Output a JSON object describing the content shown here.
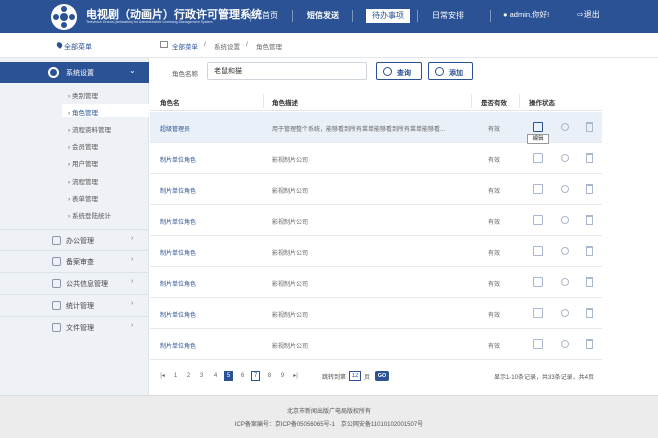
{
  "header": {
    "title": "电视剧（动画片）行政许可管理系统",
    "subtitle": "Television Drama (Animation) for Administrative Licensing Management System",
    "nav": [
      "首页",
      "短信发送",
      "待办事项",
      "日常安排"
    ],
    "active_nav": "待办事项",
    "user": "admin,你好!",
    "logout": "退出"
  },
  "sidebar": {
    "all_menu": "全部菜单",
    "active_group": "系统设置",
    "sub_items": [
      "类别管理",
      "角色管理",
      "流程资料管理",
      "会员管理",
      "用户管理",
      "流程管理",
      "表单管理",
      "系统登陆统计"
    ],
    "groups": [
      "办公管理",
      "备案审查",
      "公共信息管理",
      "统计管理",
      "文件管理"
    ]
  },
  "breadcrumb": [
    "全部菜单",
    "/",
    "系统设置",
    "/",
    "角色管理"
  ],
  "search": {
    "label": "角色名称",
    "value": "老鼠和猫",
    "query_button": "查询",
    "add_button": "添加"
  },
  "table": {
    "headers": [
      "角色名",
      "角色描述",
      "是否有效",
      "操作状态"
    ],
    "rows": [
      {
        "name": "超级管理员",
        "desc": "用于管理整个系统，能够看到所有菜单能够看到所有菜单能够看...",
        "valid": "有效"
      },
      {
        "name": "制片单位角色",
        "desc": "影视制片公司",
        "valid": "有效"
      },
      {
        "name": "制片单位角色",
        "desc": "影视制片公司",
        "valid": "有效"
      },
      {
        "name": "制片单位角色",
        "desc": "影视制片公司",
        "valid": "有效"
      },
      {
        "name": "制片单位角色",
        "desc": "影视制片公司",
        "valid": "有效"
      },
      {
        "name": "制片单位角色",
        "desc": "影视制片公司",
        "valid": "有效"
      },
      {
        "name": "制片单位角色",
        "desc": "影视制片公司",
        "valid": "有效"
      },
      {
        "name": "制片单位角色",
        "desc": "影视制片公司",
        "valid": "有效"
      }
    ],
    "tooltip": "编辑"
  },
  "pagination": {
    "pages": [
      "1",
      "2",
      "3",
      "4",
      "5",
      "6",
      "7",
      "8",
      "9"
    ],
    "current": "5",
    "jump_prefix": "跳转到第",
    "jump_value": "12",
    "jump_suffix": "页",
    "go": "GO",
    "info": "显示1-10条记录，共33条记录，共4页"
  },
  "footer": {
    "line1": "北京市新闻出版广电局版权所有",
    "line2": "ICP备案编号：京ICP备05056065号-1　京公网安备11010102001507号"
  },
  "colors": {
    "primary": "#2a5295",
    "sidebar_bg": "#eef1f5",
    "footer_bg": "#ececec"
  }
}
